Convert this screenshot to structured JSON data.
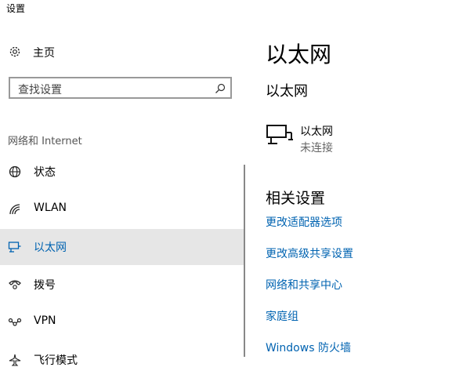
{
  "window": {
    "title": "设置"
  },
  "sidebar": {
    "home_label": "主页",
    "search": {
      "placeholder": "查找设置"
    },
    "section_label": "网络和 Internet",
    "items": [
      {
        "label": "状态",
        "icon": "status-globe-icon"
      },
      {
        "label": "WLAN",
        "icon": "wifi-icon"
      },
      {
        "label": "以太网",
        "icon": "ethernet-icon",
        "active": true
      },
      {
        "label": "拨号",
        "icon": "dialup-phone-icon"
      },
      {
        "label": "VPN",
        "icon": "vpn-icon"
      },
      {
        "label": "飞行模式",
        "icon": "airplane-icon"
      }
    ]
  },
  "main": {
    "page_title": "以太网",
    "section_title": "以太网",
    "adapter": {
      "name": "以太网",
      "status": "未连接"
    },
    "related_title": "相关设置",
    "links": [
      "更改适配器选项",
      "更改高级共享设置",
      "网络和共享中心",
      "家庭组",
      "Windows 防火墙"
    ]
  },
  "colors": {
    "accent": "#0063b1",
    "active_bg": "#e6e6e6"
  }
}
